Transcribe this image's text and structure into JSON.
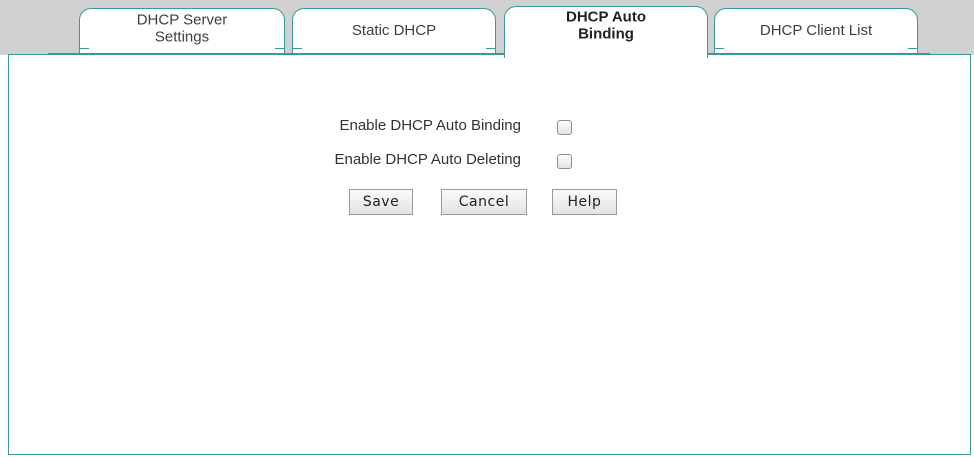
{
  "tabs": [
    {
      "label": "DHCP Server\nSettings",
      "active": false
    },
    {
      "label": "Static DHCP",
      "active": false
    },
    {
      "label": "DHCP Auto\nBinding",
      "active": true
    },
    {
      "label": "DHCP Client List",
      "active": false
    }
  ],
  "form": {
    "auto_binding_label": "Enable DHCP Auto Binding",
    "auto_binding_checked": false,
    "auto_deleting_label": "Enable DHCP Auto Deleting",
    "auto_deleting_checked": false
  },
  "buttons": {
    "save": "Save",
    "cancel": "Cancel",
    "help": "Help"
  },
  "colors": {
    "tab_border": "#3a9a9a",
    "tabstrip_bg": "#d0d0d0"
  }
}
